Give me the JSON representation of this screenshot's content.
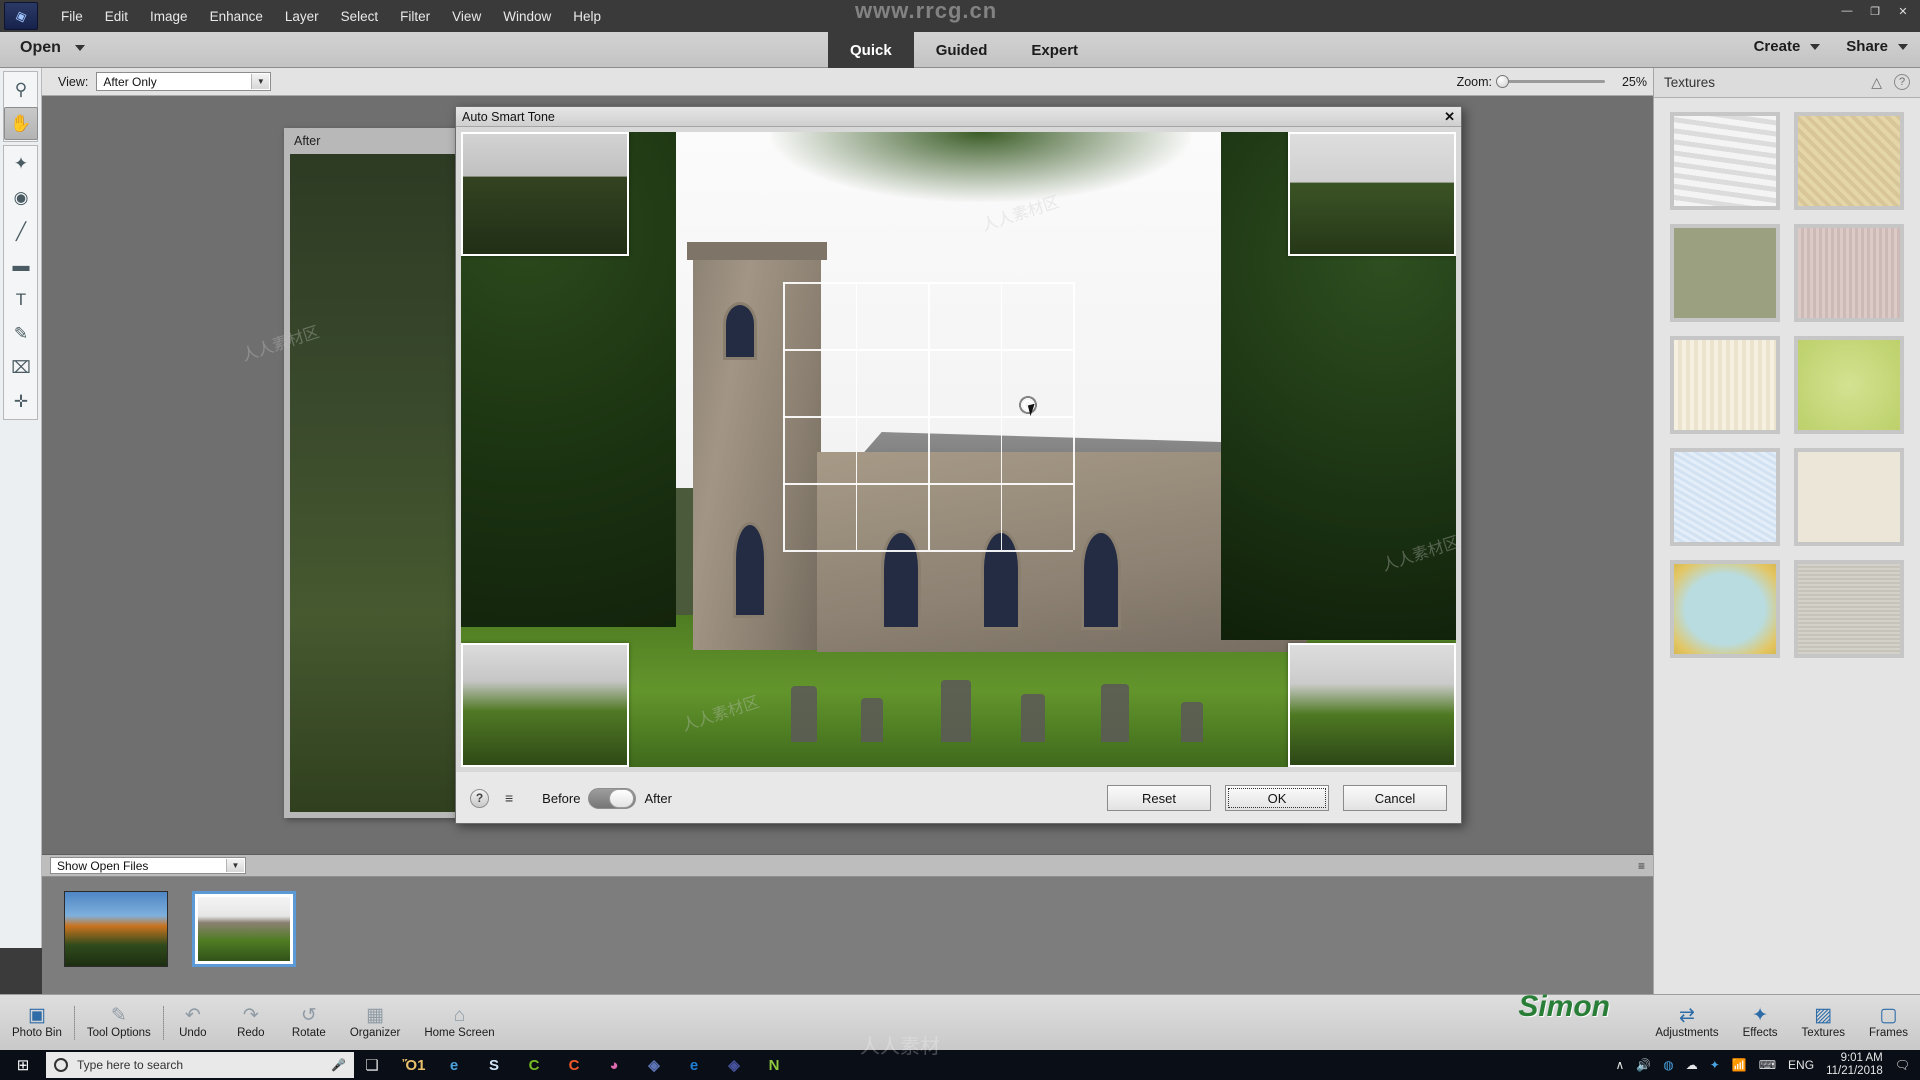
{
  "window": {
    "title_watermark": "www.rrcg.cn",
    "controls": {
      "minimize": "—",
      "maximize": "❐",
      "close": "✕"
    }
  },
  "menubar": {
    "logo_name": "photoshop-elements-logo",
    "items": [
      "File",
      "Edit",
      "Image",
      "Enhance",
      "Layer",
      "Select",
      "Filter",
      "View",
      "Window",
      "Help"
    ]
  },
  "modebar": {
    "open_label": "Open",
    "modes": [
      {
        "label": "Quick",
        "active": true
      },
      {
        "label": "Guided",
        "active": false
      },
      {
        "label": "Expert",
        "active": false
      }
    ],
    "create_label": "Create",
    "share_label": "Share"
  },
  "optionsbar": {
    "view_label": "View:",
    "view_value": "After Only",
    "zoom_label": "Zoom:",
    "zoom_value": "25%"
  },
  "tools": [
    {
      "name": "zoom-tool",
      "glyph": "⚲",
      "active": false
    },
    {
      "name": "hand-tool",
      "glyph": "✋",
      "active": true
    },
    {
      "name": "quick-selection-tool",
      "glyph": "✦",
      "active": false
    },
    {
      "name": "red-eye-tool",
      "glyph": "◉",
      "active": false
    },
    {
      "name": "whiten-teeth-tool",
      "glyph": "╱",
      "active": false
    },
    {
      "name": "straighten-tool",
      "glyph": "▬",
      "active": false
    },
    {
      "name": "type-tool",
      "glyph": "T",
      "active": false
    },
    {
      "name": "spot-healing-brush-tool",
      "glyph": "✎",
      "active": false
    },
    {
      "name": "crop-tool",
      "glyph": "⌧",
      "active": false
    },
    {
      "name": "move-tool",
      "glyph": "✛",
      "active": false
    }
  ],
  "document": {
    "label": "After",
    "close_glyph": "✖"
  },
  "dialog": {
    "title": "Auto Smart Tone",
    "close_glyph": "✕",
    "help_glyph": "?",
    "menu_glyph": "≡",
    "before_label": "Before",
    "after_label": "After",
    "buttons": [
      {
        "label": "Reset",
        "name": "reset-button",
        "default": false
      },
      {
        "label": "OK",
        "name": "ok-button",
        "default": true
      },
      {
        "label": "Cancel",
        "name": "cancel-button",
        "default": false
      }
    ]
  },
  "photobin": {
    "filter_value": "Show Open Files",
    "thumbs": [
      {
        "name": "photo-bin-thumb-1",
        "selected": false
      },
      {
        "name": "photo-bin-thumb-2",
        "selected": true
      }
    ]
  },
  "rightpanel": {
    "title": "Textures",
    "collapse_glyph": "△",
    "help_glyph": "?",
    "textures": [
      {
        "name": "texture-peeling-paint",
        "color": "#e9e9e9"
      },
      {
        "name": "texture-burlap-tan",
        "color": "#e2d3a8"
      },
      {
        "name": "texture-olive-canvas",
        "color": "#9ba081"
      },
      {
        "name": "texture-mauve-fibers",
        "color": "#d6c4c0"
      },
      {
        "name": "texture-cream-linen",
        "color": "#f4eddd"
      },
      {
        "name": "texture-green-sunburst",
        "color": "#c3d57a"
      },
      {
        "name": "texture-frost-blue",
        "color": "#dce8f4"
      },
      {
        "name": "texture-parchment",
        "color": "#ebe6d8"
      },
      {
        "name": "texture-aqua-vintage",
        "color": "#b4d8dc"
      },
      {
        "name": "texture-stucco-grey",
        "color": "#cfcdc3"
      }
    ]
  },
  "apptoolbar": {
    "left_items": [
      {
        "label": "Photo Bin",
        "icon": "photo-bin-icon",
        "glyph": "ὛB",
        "active": true
      },
      {
        "label": "Tool Options",
        "icon": "tool-options-icon",
        "glyph": "✎",
        "active": false
      },
      {
        "label": "Undo",
        "icon": "undo-icon",
        "glyph": "↶",
        "active": false
      },
      {
        "label": "Redo",
        "icon": "redo-icon",
        "glyph": "↷",
        "active": false
      },
      {
        "label": "Rotate",
        "icon": "rotate-icon",
        "glyph": "↺",
        "active": false
      },
      {
        "label": "Organizer",
        "icon": "organizer-icon",
        "glyph": "▦",
        "active": false
      },
      {
        "label": "Home Screen",
        "icon": "home-icon",
        "glyph": "⌂",
        "active": false
      }
    ],
    "right_items": [
      {
        "label": "Adjustments",
        "icon": "adjustments-icon",
        "glyph": "≡"
      },
      {
        "label": "Effects",
        "icon": "effects-icon",
        "glyph": "✨"
      },
      {
        "label": "Textures",
        "icon": "textures-icon",
        "glyph": "▧"
      },
      {
        "label": "Frames",
        "icon": "frames-icon",
        "glyph": "▢"
      }
    ],
    "watermark": "Simon"
  },
  "taskbar": {
    "start_glyph": "⊞",
    "search_placeholder": "Type here to search",
    "search_icon": "search-circle-icon",
    "mic_icon": "microphone-icon",
    "taskview_icon": "task-view-icon",
    "apps": [
      {
        "name": "file-explorer-icon",
        "glyph": "Ὄ1",
        "color": "#e8c06a"
      },
      {
        "name": "internet-explorer-icon",
        "glyph": "e",
        "color": "#4aa3e0"
      },
      {
        "name": "skype-icon",
        "glyph": "S",
        "color": "#cfe4f7"
      },
      {
        "name": "camtasia-icon",
        "glyph": "C",
        "color": "#76bc21"
      },
      {
        "name": "camtasia-studio-icon",
        "glyph": "C",
        "color": "#f1592a"
      },
      {
        "name": "photos-icon",
        "glyph": "◕",
        "color": "#e06ab0"
      },
      {
        "name": "photoshop-elements-icon",
        "glyph": "◈",
        "color": "#5d74b5"
      },
      {
        "name": "edge-icon",
        "glyph": "e",
        "color": "#1e7fd4"
      },
      {
        "name": "elements-editor-icon",
        "glyph": "◈",
        "color": "#46539c"
      },
      {
        "name": "nvidia-icon",
        "glyph": "N",
        "color": "#8fc73e"
      }
    ],
    "tray": {
      "chevron": "∧",
      "volume_icon": "volume-icon",
      "onedrive_icon": "onedrive-icon",
      "cloud_icon": "cloud-icon",
      "dropbox_icon": "dropbox-icon",
      "wifi_icon": "wifi-icon",
      "keyboard_icon": "keyboard-icon",
      "language": "ENG",
      "time": "9:01 AM",
      "date": "11/21/2018"
    }
  }
}
